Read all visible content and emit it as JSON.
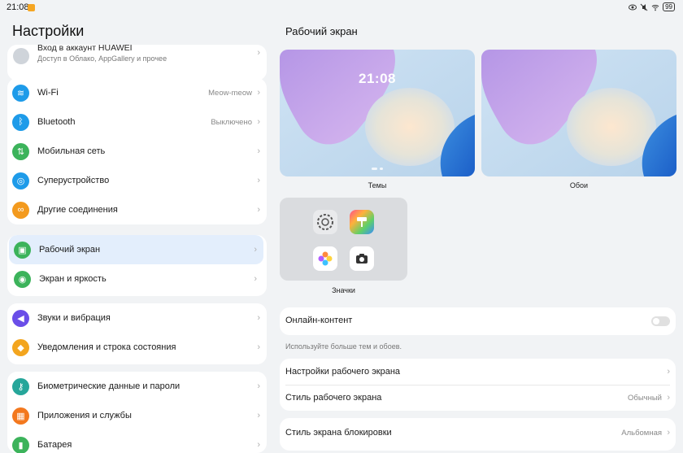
{
  "status_bar": {
    "time": "21:08",
    "battery": "99"
  },
  "left": {
    "title": "Настройки",
    "account": {
      "name": "Вход в аккаунт HUAWEI",
      "subtitle": "Доступ в Облако, AppGallery и прочее"
    },
    "group1": [
      {
        "label": "Wi-Fi",
        "value": "Meow-meow",
        "icon": "wifi-icon",
        "color": "#1e9be9"
      },
      {
        "label": "Bluetooth",
        "value": "Выключено",
        "icon": "bluetooth-icon",
        "color": "#1e9be9"
      },
      {
        "label": "Мобильная сеть",
        "value": "",
        "icon": "mobile-network-icon",
        "color": "#3cb35b"
      },
      {
        "label": "Суперустройство",
        "value": "",
        "icon": "superdevice-icon",
        "color": "#1e9be9"
      },
      {
        "label": "Другие соединения",
        "value": "",
        "icon": "link-icon",
        "color": "#f39a1e"
      }
    ],
    "group2": [
      {
        "label": "Рабочий экран",
        "icon": "home-screen-icon",
        "color": "#3cb35b"
      },
      {
        "label": "Экран и яркость",
        "icon": "eye-icon",
        "color": "#3cb35b"
      }
    ],
    "group3": [
      {
        "label": "Звуки и вибрация",
        "icon": "sound-icon",
        "color": "#6a4ee8"
      },
      {
        "label": "Уведомления и строка состояния",
        "icon": "bell-icon",
        "color": "#f3a51e"
      }
    ],
    "group4": [
      {
        "label": "Биометрические данные и пароли",
        "icon": "key-icon",
        "color": "#26a69a"
      },
      {
        "label": "Приложения и службы",
        "icon": "apps-icon",
        "color": "#f3781e"
      },
      {
        "label": "Батарея",
        "icon": "battery-icon",
        "color": "#3cb35b"
      }
    ]
  },
  "right": {
    "title": "Рабочий экран",
    "themes_label": "Темы",
    "wallpapers_label": "Обои",
    "icons_label": "Значки",
    "lock_clock": "21:08",
    "online": {
      "label": "Онлайн-контент",
      "hint": "Используйте больше тем и обоев.",
      "enabled": false
    },
    "settings": [
      {
        "label": "Настройки рабочего экрана",
        "value": ""
      },
      {
        "label": "Стиль рабочего экрана",
        "value": "Обычный"
      }
    ],
    "lock_style": {
      "label": "Стиль экрана блокировки",
      "value": "Альбомная"
    }
  }
}
